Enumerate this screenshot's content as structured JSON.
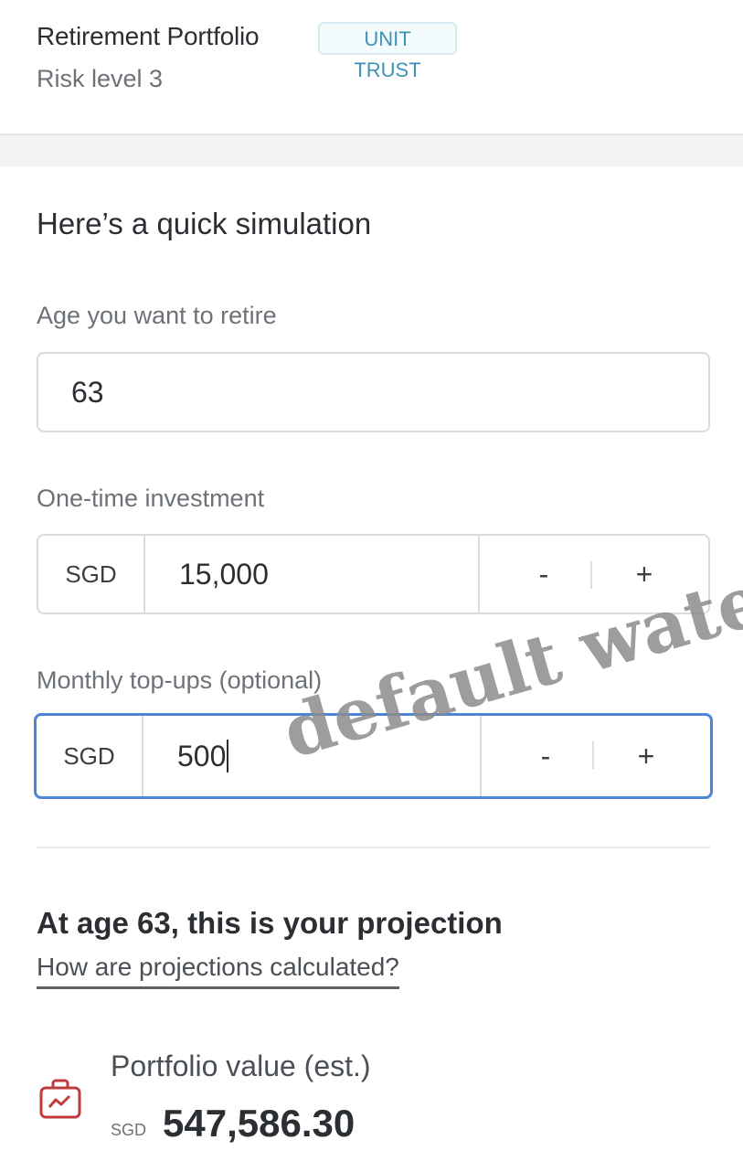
{
  "header": {
    "product_name": "Retirement Portfolio",
    "badge": "UNIT TRUST",
    "risk_level": "Risk level 3"
  },
  "simulation": {
    "title": "Here’s a quick simulation",
    "retire_age": {
      "label": "Age you want to retire",
      "value": "63"
    },
    "one_time": {
      "label": "One-time investment",
      "currency": "SGD",
      "value": "15,000",
      "minus": "-",
      "plus": "+"
    },
    "monthly": {
      "label": "Monthly top-ups (optional)",
      "currency": "SGD",
      "value": "500",
      "minus": "-",
      "plus": "+"
    }
  },
  "projection": {
    "title": "At age 63, this is your projection",
    "link": "How are projections calculated?",
    "portfolio_label": "Portfolio value (est.)",
    "currency": "SGD",
    "value": "547,586.30",
    "icon": "portfolio-briefcase-icon"
  },
  "watermark": "default waterma",
  "colors": {
    "accent_focus": "#4d86d6",
    "badge_text": "#3d93b4",
    "icon_red": "#c23b3b"
  }
}
